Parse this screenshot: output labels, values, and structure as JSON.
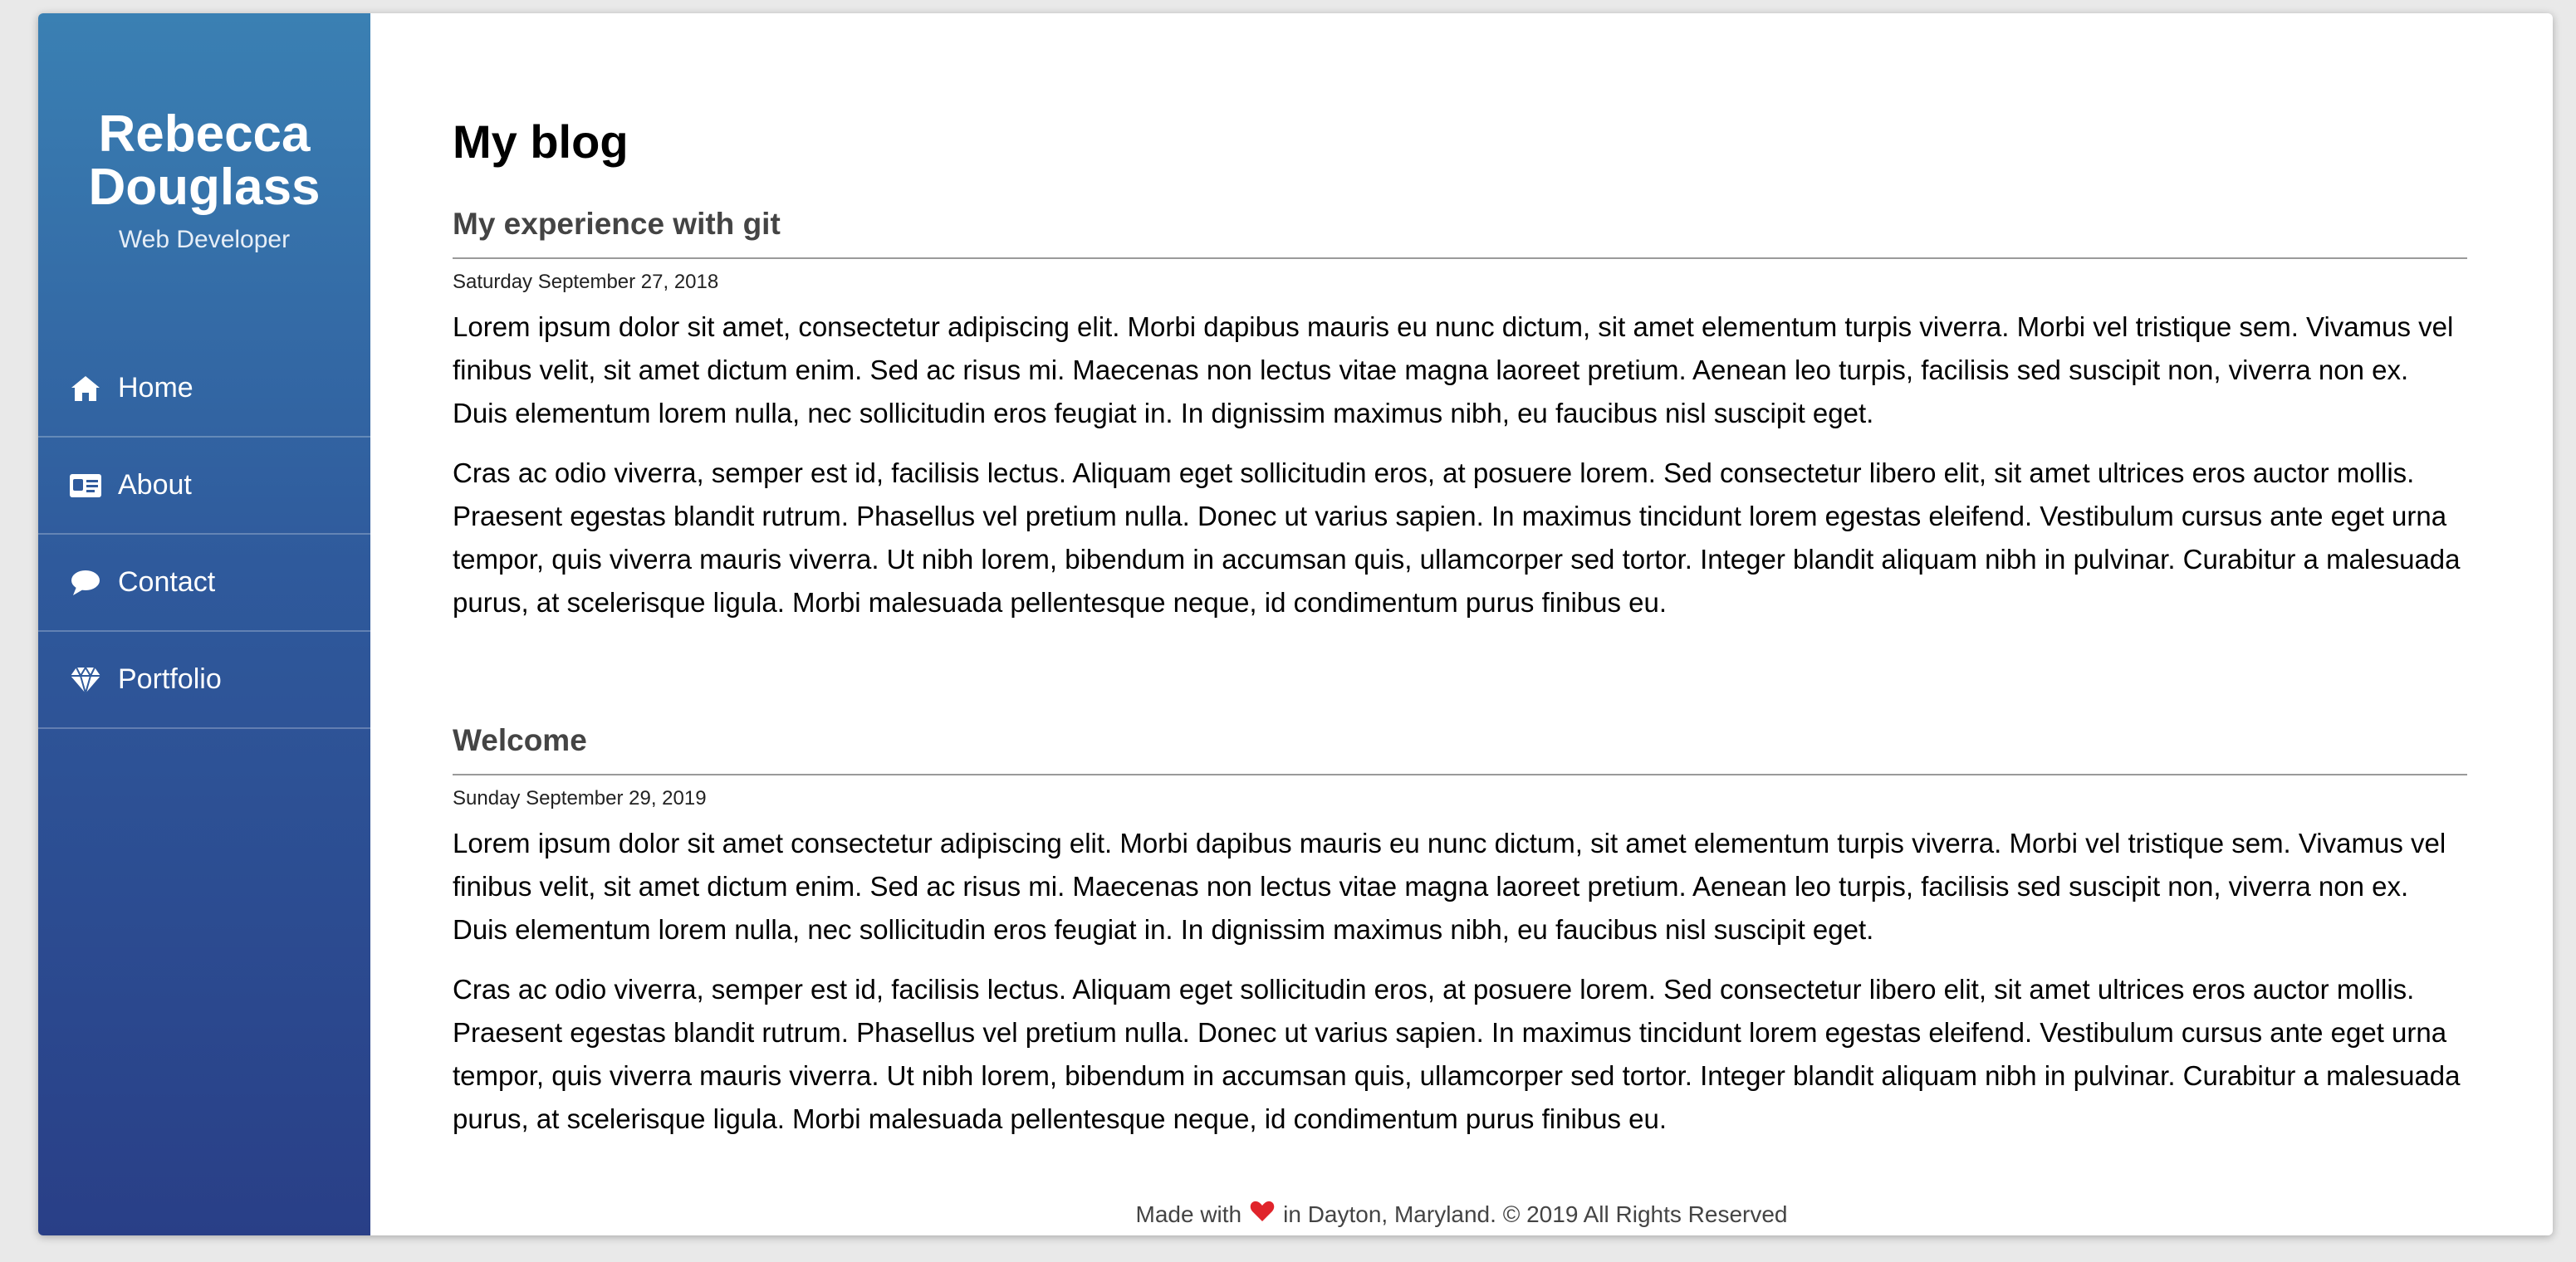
{
  "sidebar": {
    "name_line1": "Rebecca",
    "name_line2": "Douglass",
    "role": "Web Developer",
    "items": [
      {
        "label": "Home",
        "icon": "home-icon"
      },
      {
        "label": "About",
        "icon": "id-card-icon"
      },
      {
        "label": "Contact",
        "icon": "chat-icon"
      },
      {
        "label": "Portfolio",
        "icon": "diamond-icon"
      }
    ]
  },
  "main": {
    "title": "My blog",
    "posts": [
      {
        "title": "My experience with git",
        "date": "Saturday September 27, 2018",
        "paragraphs": [
          "Lorem ipsum dolor sit amet, consectetur adipiscing elit. Morbi dapibus mauris eu nunc dictum, sit amet elementum turpis viverra. Morbi vel tristique sem. Vivamus vel finibus velit, sit amet dictum enim. Sed ac risus mi. Maecenas non lectus vitae magna laoreet pretium. Aenean leo turpis, facilisis sed suscipit non, viverra non ex. Duis elementum lorem nulla, nec sollicitudin eros feugiat in. In dignissim maximus nibh, eu faucibus nisl suscipit eget.",
          "Cras ac odio viverra, semper est id, facilisis lectus. Aliquam eget sollicitudin eros, at posuere lorem. Sed consectetur libero elit, sit amet ultrices eros auctor mollis. Praesent egestas blandit rutrum. Phasellus vel pretium nulla. Donec ut varius sapien. In maximus tincidunt lorem egestas eleifend. Vestibulum cursus ante eget urna tempor, quis viverra mauris viverra. Ut nibh lorem, bibendum in accumsan quis, ullamcorper sed tortor. Integer blandit aliquam nibh in pulvinar. Curabitur a malesuada purus, at scelerisque ligula. Morbi malesuada pellentesque neque, id condimentum purus finibus eu."
        ]
      },
      {
        "title": "Welcome",
        "date": "Sunday September 29, 2019",
        "paragraphs": [
          "Lorem ipsum dolor sit amet consectetur adipiscing elit. Morbi dapibus mauris eu nunc dictum, sit amet elementum turpis viverra. Morbi vel tristique sem. Vivamus vel finibus velit, sit amet dictum enim. Sed ac risus mi. Maecenas non lectus vitae magna laoreet pretium. Aenean leo turpis, facilisis sed suscipit non, viverra non ex. Duis elementum lorem nulla, nec sollicitudin eros feugiat in. In dignissim maximus nibh, eu faucibus nisl suscipit eget.",
          "Cras ac odio viverra, semper est id, facilisis lectus. Aliquam eget sollicitudin eros, at posuere lorem. Sed consectetur libero elit, sit amet ultrices eros auctor mollis. Praesent egestas blandit rutrum. Phasellus vel pretium nulla. Donec ut varius sapien. In maximus tincidunt lorem egestas eleifend. Vestibulum cursus ante eget urna tempor, quis viverra mauris viverra. Ut nibh lorem, bibendum in accumsan quis, ullamcorper sed tortor. Integer blandit aliquam nibh in pulvinar. Curabitur a malesuada purus, at scelerisque ligula. Morbi malesuada pellentesque neque, id condimentum purus finibus eu."
        ]
      }
    ]
  },
  "footer": {
    "before_heart": "Made with",
    "after_heart": "in Dayton, Maryland. © 2019 All Rights Reserved",
    "heart_icon": "heart-icon"
  },
  "colors": {
    "sidebar_top": "#3a80b3",
    "sidebar_bottom": "#293f87",
    "heart": "#e0242b"
  }
}
